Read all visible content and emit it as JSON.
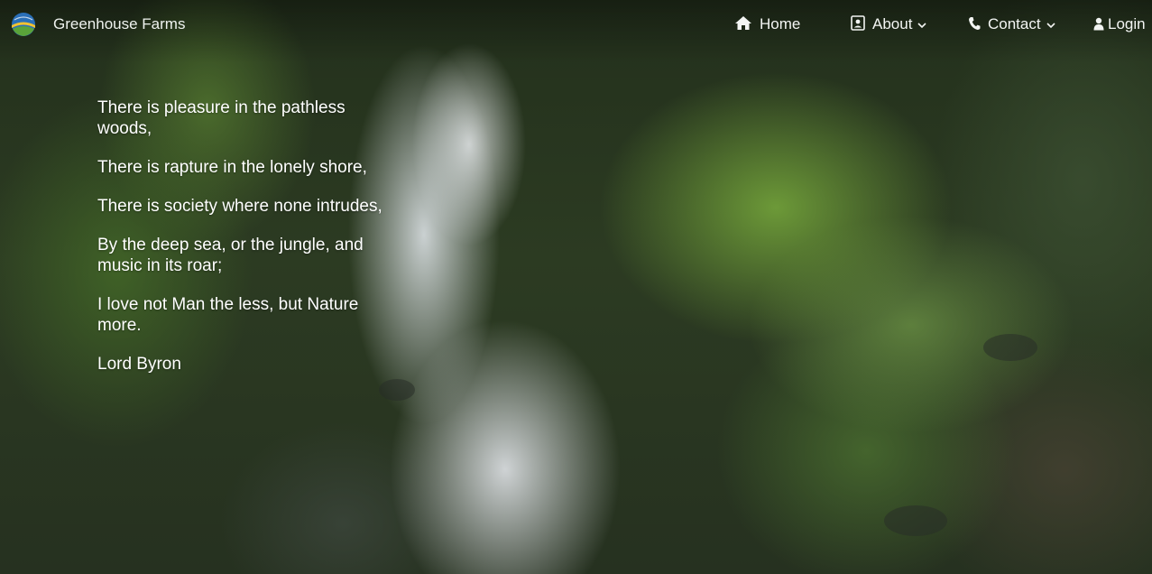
{
  "brand": {
    "name": "Greenhouse Farms",
    "logo_icon": "globe-logo-icon"
  },
  "nav": {
    "home": {
      "label": "Home",
      "icon": "home-icon"
    },
    "about": {
      "label": "About",
      "icon": "contact-card-icon",
      "has_dropdown": true
    },
    "contact": {
      "label": "Contact",
      "icon": "phone-icon",
      "has_dropdown": true
    },
    "login": {
      "label": "Login",
      "icon": "user-icon"
    }
  },
  "poem": {
    "lines": [
      "There is pleasure in the pathless woods,",
      "There is rapture in the lonely shore,",
      "There is society where none intrudes,",
      "By the deep sea, or the jungle, and music in its roar;",
      "I love not Man the less, but Nature more."
    ],
    "author": "Lord Byron"
  },
  "colors": {
    "nav_text": "#f3f5f3",
    "poem_text": "#ffffff",
    "logo_blue": "#2a6fb8",
    "logo_green": "#5aa33a",
    "logo_yellow": "#f2c230"
  }
}
